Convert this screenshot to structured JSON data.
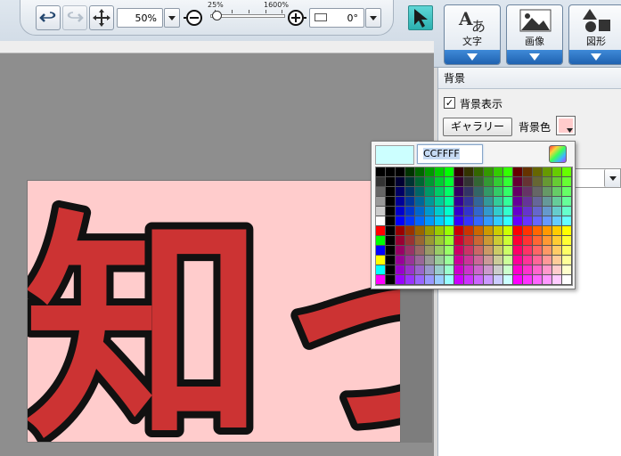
{
  "toolbar": {
    "zoom_value": "50%",
    "zoom_min_label": "25%",
    "zoom_max_label": "1600%",
    "rotation_value": "0°",
    "zoom_level": 0.03
  },
  "big_buttons": [
    {
      "label": "文字",
      "icon": "text-icon"
    },
    {
      "label": "画像",
      "icon": "image-icon"
    },
    {
      "label": "図形",
      "icon": "shapes-icon"
    }
  ],
  "panel": {
    "header": "背景",
    "show_background_label": "背景表示",
    "show_background_checked": true,
    "gallery_button": "ギャラリー",
    "bg_color_label": "背景色",
    "bg_color": "#ffcccc"
  },
  "picker": {
    "hex_value": "CCFFFF",
    "preview_color": "#ccffff"
  },
  "canvas": {
    "text": "知っ",
    "text_color": "#cc3333",
    "stroke_color": "#111111",
    "paper_color": "#ffcccc"
  }
}
